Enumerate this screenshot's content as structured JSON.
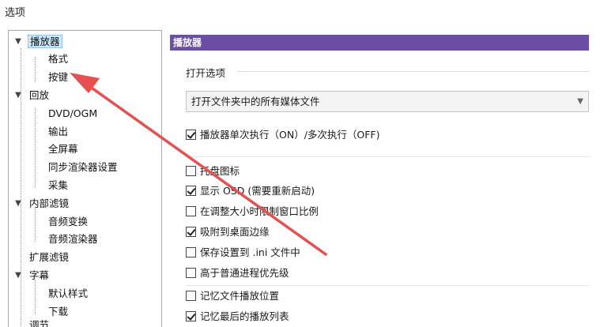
{
  "window": {
    "title": "选项"
  },
  "tree": {
    "items": [
      {
        "label": "播放器",
        "selected": true
      },
      {
        "label": "格式"
      },
      {
        "label": "按键"
      },
      {
        "label": "回放"
      },
      {
        "label": "DVD/OGM"
      },
      {
        "label": "输出"
      },
      {
        "label": "全屏幕"
      },
      {
        "label": "同步渲染器设置"
      },
      {
        "label": "采集"
      },
      {
        "label": "内部滤镜"
      },
      {
        "label": "音频变换"
      },
      {
        "label": "音频渲染器"
      },
      {
        "label": "扩展滤镜"
      },
      {
        "label": "字幕"
      },
      {
        "label": "默认样式"
      },
      {
        "label": "下载"
      },
      {
        "label": "调节"
      }
    ]
  },
  "panel": {
    "header": "播放器",
    "open_group_label": "打开选项",
    "open_dropdown_value": "打开文件夹中的所有媒体文件",
    "single_instance": {
      "label": "播放器单次执行（ON）/多次执行（OFF)",
      "checked": true
    },
    "options": [
      {
        "label": "托盘图标",
        "checked": false
      },
      {
        "label": "显示 OSD (需要重新启动)",
        "checked": true
      },
      {
        "label": "在调整大小时限制窗口比例",
        "checked": false
      },
      {
        "label": "吸附到桌面边缘",
        "checked": true
      },
      {
        "label": "保存设置到 .ini 文件中",
        "checked": false
      },
      {
        "label": "高于普通进程优先级",
        "checked": false
      },
      {
        "label": "记忆文件播放位置",
        "checked": false
      },
      {
        "label": "记忆最后的播放列表",
        "checked": true
      }
    ]
  },
  "colors": {
    "header_bg": "#6a4fa3",
    "annotation_arrow": "#e8504f",
    "selection": "#cce8ff"
  }
}
